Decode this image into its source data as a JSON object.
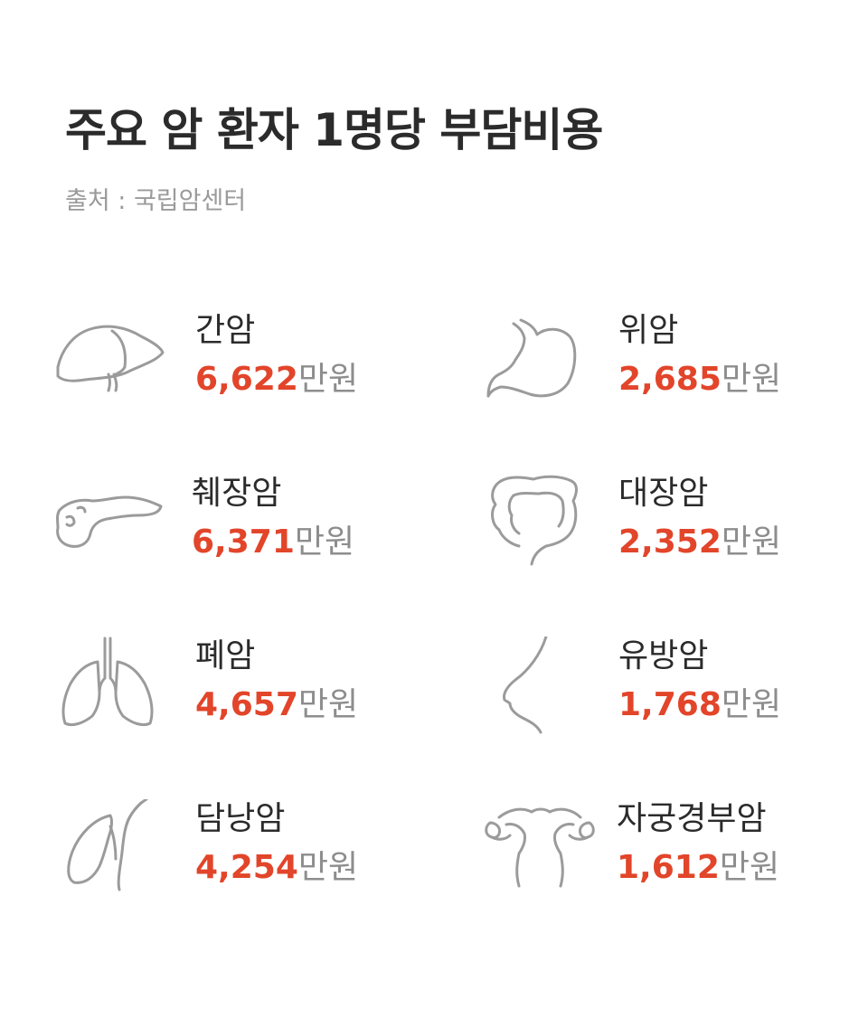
{
  "header": {
    "title": "주요 암 환자 1명당 부담비용",
    "source": "출처 : 국립암센터"
  },
  "colors": {
    "amount": "#e2452a",
    "unit": "#8d8d8d",
    "icon": "#9b9b9b",
    "title": "#2b2b2b"
  },
  "unit_label": "만원",
  "cancers": [
    {
      "name": "간암",
      "amount": "6,622",
      "unit": "만원",
      "icon": "liver-icon"
    },
    {
      "name": "위암",
      "amount": "2,685",
      "unit": "만원",
      "icon": "stomach-icon"
    },
    {
      "name": "췌장암",
      "amount": "6,371",
      "unit": "만원",
      "icon": "pancreas-icon"
    },
    {
      "name": "대장암",
      "amount": "2,352",
      "unit": "만원",
      "icon": "colon-icon"
    },
    {
      "name": "폐암",
      "amount": "4,657",
      "unit": "만원",
      "icon": "lungs-icon"
    },
    {
      "name": "유방암",
      "amount": "1,768",
      "unit": "만원",
      "icon": "breast-icon"
    },
    {
      "name": "담낭암",
      "amount": "4,254",
      "unit": "만원",
      "icon": "gallbladder-icon"
    },
    {
      "name": "자궁경부암",
      "amount": "1,612",
      "unit": "만원",
      "icon": "uterus-icon"
    }
  ]
}
